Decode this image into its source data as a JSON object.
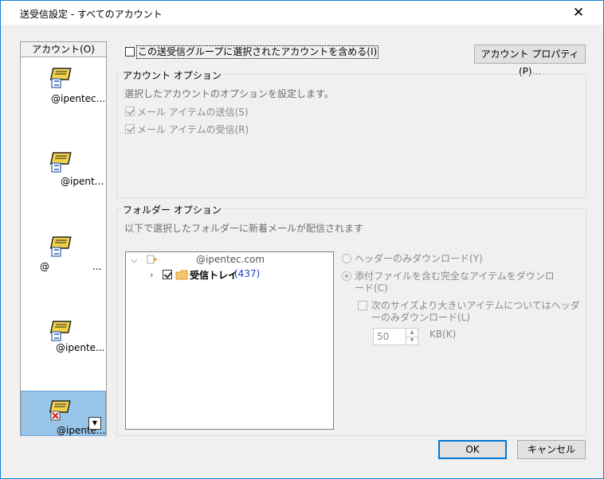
{
  "window": {
    "title": "送受信設定 - すべてのアカウント"
  },
  "accounts": {
    "header": "アカウント(O)",
    "items": [
      {
        "label": "@ipentec..."
      },
      {
        "label": "@ipent..."
      },
      {
        "label_left": "@",
        "label_right": "..."
      },
      {
        "label": "@ipente..."
      },
      {
        "label": "@ipente..."
      }
    ]
  },
  "top": {
    "include_label": "この送受信グループに選択されたアカウントを含める(I)",
    "include_checked": false,
    "properties_button": "アカウント プロパティ(P)..."
  },
  "account_options": {
    "title": "アカウント オプション",
    "description": "選択したアカウントのオプションを設定します。",
    "send_label": "メール アイテムの送信(S)",
    "receive_label": "メール アイテムの受信(R)"
  },
  "folder_options": {
    "title": "フォルダー オプション",
    "description": "以下で選択したフォルダーに新着メールが配信されます",
    "tree": {
      "root_label": "@ipentec.com",
      "inbox_label": "受信トレイ",
      "inbox_count": "(437)"
    },
    "radio_headers": "ヘッダーのみダウンロード(Y)",
    "radio_full_line1": "添付ファイルを含む完全なアイテムをダウンロ",
    "radio_full_line2": "ード(C)",
    "size_check_line1": "次のサイズより大きいアイテムについてはヘッダ",
    "size_check_line2": "ーのみダウンロード(L)",
    "size_value": "50",
    "size_unit": "KB(K)"
  },
  "buttons": {
    "ok": "OK",
    "cancel": "キャンセル"
  },
  "colors": {
    "accent": "#0078d7",
    "selected": "#99c5e8",
    "inbox_count": "#1a3fd0"
  }
}
